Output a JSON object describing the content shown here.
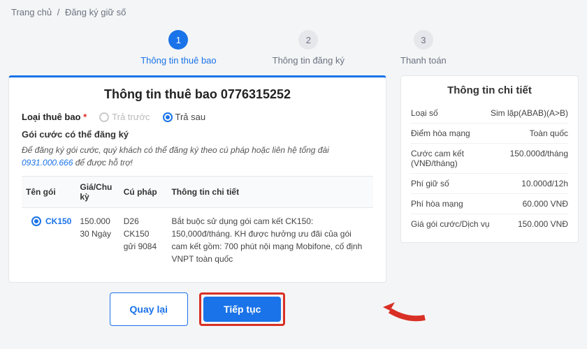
{
  "breadcrumb": {
    "home": "Trang chủ",
    "sep": "/",
    "current": "Đăng ký giữ số"
  },
  "steps": [
    {
      "num": "1",
      "label": "Thông tin thuê bao"
    },
    {
      "num": "2",
      "label": "Thông tin đăng ký"
    },
    {
      "num": "3",
      "label": "Thanh toán"
    }
  ],
  "card": {
    "title": "Thông tin thuê bao 0776315252",
    "subtype_label": "Loại thuê bao",
    "prepaid": "Trả trước",
    "postpaid": "Trả sau",
    "plans_label": "Gói cước có thể đăng ký",
    "note_a": "Để đăng ký gói cước, quý khách có thể đăng ký theo cú pháp hoặc liên hệ tổng đài ",
    "hotline": "0931.000.666",
    "note_b": " để được hỗ trợ!",
    "headers": {
      "name": "Tên gói",
      "price": "Giá/Chu kỳ",
      "syntax": "Cú pháp",
      "info": "Thông tin chi tiết"
    },
    "row": {
      "name": "CK150",
      "price": "150.000\n30 Ngày",
      "syntax": "D26 CK150 gửi 9084",
      "info": "Bắt buộc sử dụng gói cam kết CK150: 150,000đ/tháng. KH được hưởng ưu đãi của gói cam kết gồm: 700 phút nội mạng Mobifone, cố định VNPT toàn quốc"
    },
    "back": "Quay lại",
    "next": "Tiếp tục"
  },
  "details": {
    "title": "Thông tin chi tiết",
    "rows": [
      {
        "k": "Loại số",
        "v": "Sim lặp(ABAB)(A>B)"
      },
      {
        "k": "Điểm hòa mạng",
        "v": "Toàn quốc"
      },
      {
        "k": "Cước cam kết (VNĐ/tháng)",
        "v": "150.000đ/tháng"
      },
      {
        "k": "Phí giữ số",
        "v": "10.000đ/12h"
      },
      {
        "k": "Phí hòa mạng",
        "v": "60.000 VNĐ"
      },
      {
        "k": "Giá gói cước/Dịch vụ",
        "v": "150.000 VNĐ"
      }
    ]
  }
}
